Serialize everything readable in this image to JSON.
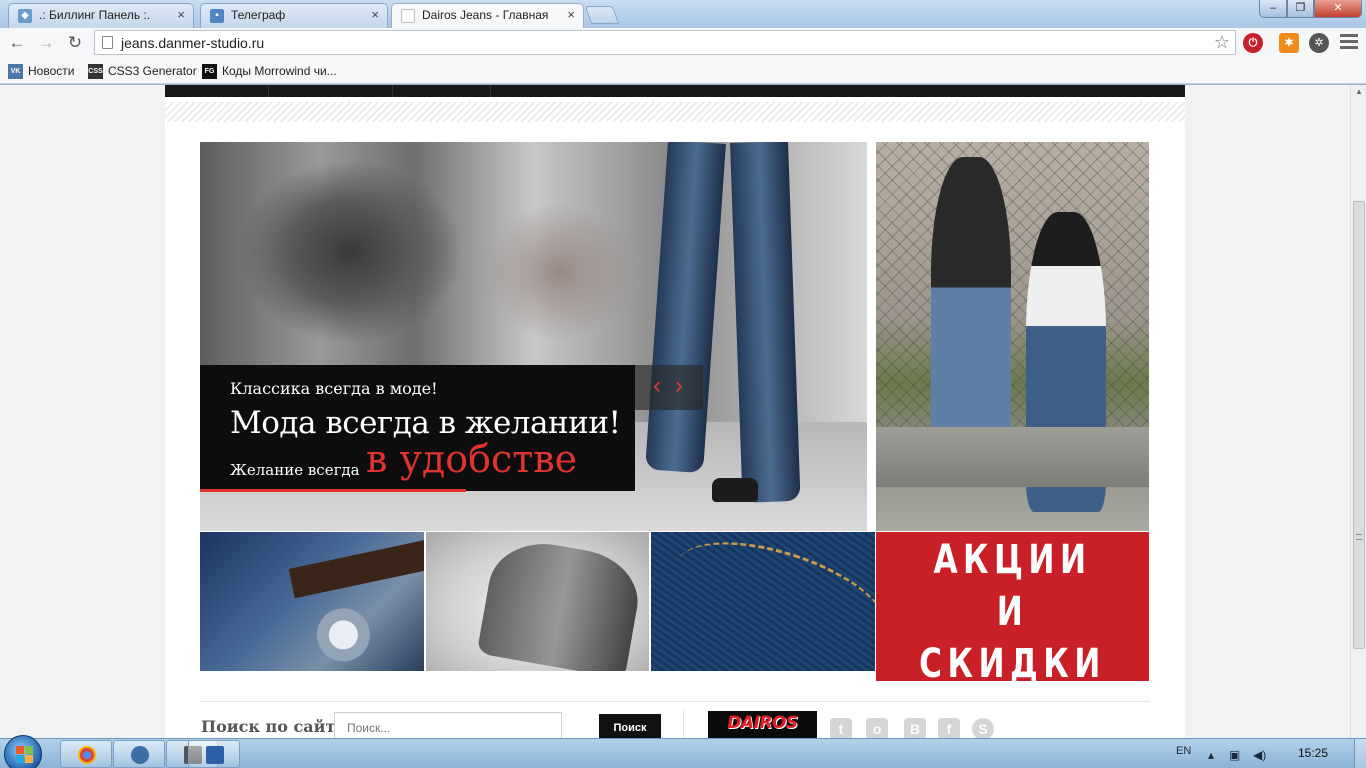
{
  "browser": {
    "tabs": [
      {
        "label": ".: Биллинг Панель :.",
        "active": false
      },
      {
        "label": "Телеграф",
        "active": false
      },
      {
        "label": "Dairos Jeans - Главная",
        "active": true
      }
    ],
    "url": "jeans.danmer-studio.ru",
    "bookmarks": [
      "Новости",
      "CSS3 Generator",
      "Коды Morrowind чи..."
    ],
    "bookmark_icons": [
      "vk-icon",
      "css3-icon",
      "fg-icon"
    ]
  },
  "slider": {
    "line1": "Классика всегда в моде!",
    "line2": "Мода всегда в желании!",
    "line3": "Желание всегда",
    "line4": "в удобстве",
    "prev": "‹",
    "next": "›",
    "accent_color": "#e2342f"
  },
  "promo": {
    "line1": "АКЦИИ",
    "line2": "И",
    "line3": "СКИДКИ",
    "color": "#c91f26"
  },
  "footer": {
    "search_label": "Поиск по сайту",
    "search_placeholder": "Поиск...",
    "search_button": "Поиск",
    "logo_text": "DAIROS",
    "social": [
      "twitter-icon",
      "odnoklassniki-icon",
      "vkontakte-icon",
      "facebook-icon",
      "skype-icon"
    ]
  },
  "taskbar": {
    "lang": "EN",
    "time": "15:25"
  }
}
